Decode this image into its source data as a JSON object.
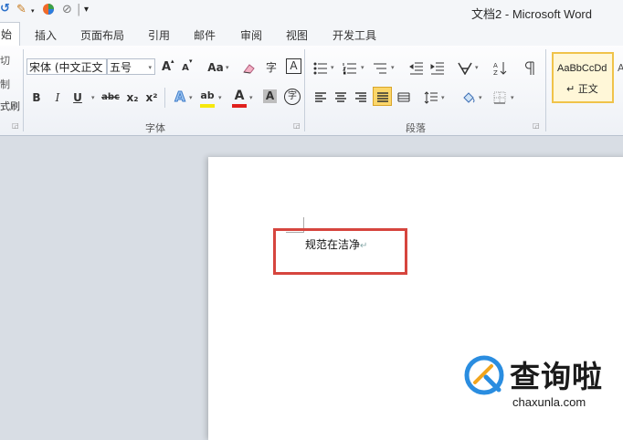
{
  "window": {
    "title": "文档2 - Microsoft Word"
  },
  "quick_access": {
    "customize": "▾"
  },
  "tabs": [
    "始",
    "插入",
    "页面布局",
    "引用",
    "邮件",
    "审阅",
    "视图",
    "开发工具"
  ],
  "clipboard_partial": [
    "切",
    "制",
    "式刷"
  ],
  "font_group": {
    "label": "字体",
    "font_name": "宋体 (中文正文",
    "font_size": "五号",
    "grow": "A",
    "shrink": "A",
    "change_case": "Aa",
    "phonetic": "字",
    "char_border": "A",
    "bold": "B",
    "italic": "I",
    "underline": "U",
    "strikethrough": "abc",
    "subscript": "x₂",
    "superscript": "x²",
    "text_effects": "A",
    "highlight": "ab",
    "font_color": "A",
    "char_shading": "A",
    "enclosed": "字"
  },
  "paragraph_group": {
    "label": "段落"
  },
  "styles_group": {
    "tile_preview": "AaBbCcDd",
    "tile_name": "↵ 正文"
  },
  "colors": {
    "accent_red": "#d6453e",
    "highlight_yellow": "#f0c34a",
    "font_red": "#e0201c",
    "watermark_blue": "#2a8de0"
  },
  "document": {
    "text": "规范在洁净",
    "para_mark": "↵"
  },
  "watermark": {
    "title": "查询啦",
    "subtitle": "chaxunla.com"
  }
}
